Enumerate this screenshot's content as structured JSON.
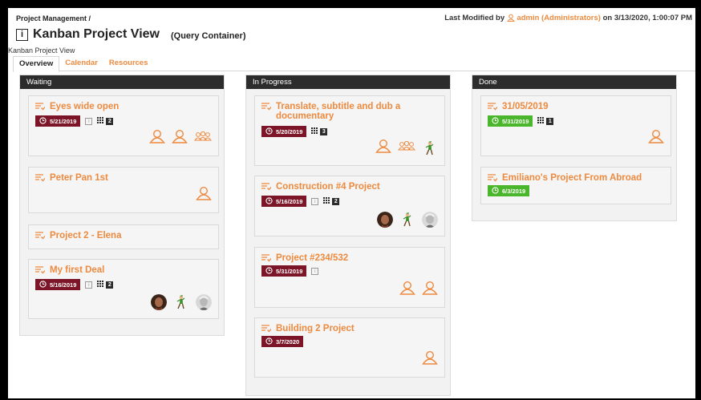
{
  "breadcrumb": "Project Management /",
  "last_modified": {
    "prefix": "Last Modified by",
    "user": "admin (Administrators)",
    "suffix": "on 3/13/2020, 1:00:07 PM"
  },
  "title": "Kanban Project View",
  "subtitle": "(Query Container)",
  "view_label": "Kanban Project View",
  "tabs": [
    "Overview",
    "Calendar",
    "Resources"
  ],
  "colors": {
    "accent": "#ee8a3f",
    "late": "#7d1528",
    "on_time": "#49b62b",
    "header": "#2c2c2c"
  },
  "columns": [
    {
      "name": "Waiting",
      "cards": [
        {
          "title": "Eyes wide open",
          "date": "5/21/2019",
          "status": "late",
          "info_icon": true,
          "task_count": "2",
          "icons": [
            "user-outline-icon",
            "user-outline-icon",
            "group-icon"
          ]
        },
        {
          "title": "Peter Pan 1st",
          "icons": [
            "user-outline-icon"
          ]
        },
        {
          "title": "Project 2 - Elena"
        },
        {
          "title": "My first Deal",
          "date": "5/16/2019",
          "status": "late",
          "info_icon": true,
          "task_count": "2",
          "icons": [
            "avatar-woman",
            "avatar-elf",
            "avatar-old-man"
          ]
        }
      ]
    },
    {
      "name": "In Progress",
      "cards": [
        {
          "title": "Translate, subtitle and dub a documentary",
          "date": "5/20/2019",
          "status": "late",
          "task_count": "3",
          "icons": [
            "user-outline-icon",
            "group-icon",
            "avatar-elf"
          ]
        },
        {
          "title": "Construction #4 Project",
          "date": "5/16/2019",
          "status": "late",
          "info_icon": true,
          "task_count": "2",
          "icons": [
            "avatar-woman",
            "avatar-elf",
            "avatar-old-man"
          ]
        },
        {
          "title": "Project #234/532",
          "date": "5/31/2019",
          "status": "late",
          "info_icon": true,
          "icons": [
            "user-outline-icon",
            "user-outline-icon"
          ]
        },
        {
          "title": "Building 2 Project",
          "date": "3/7/2020",
          "status": "late",
          "icons": [
            "user-outline-icon"
          ]
        }
      ]
    },
    {
      "name": "Done",
      "cards": [
        {
          "title": "31/05/2019",
          "date": "5/31/2019",
          "status": "ok",
          "task_count": "1",
          "icons": [
            "user-outline-icon"
          ]
        },
        {
          "title": "Emiliano's Project From Abroad",
          "date": "6/3/2019",
          "status": "ok"
        }
      ]
    }
  ]
}
